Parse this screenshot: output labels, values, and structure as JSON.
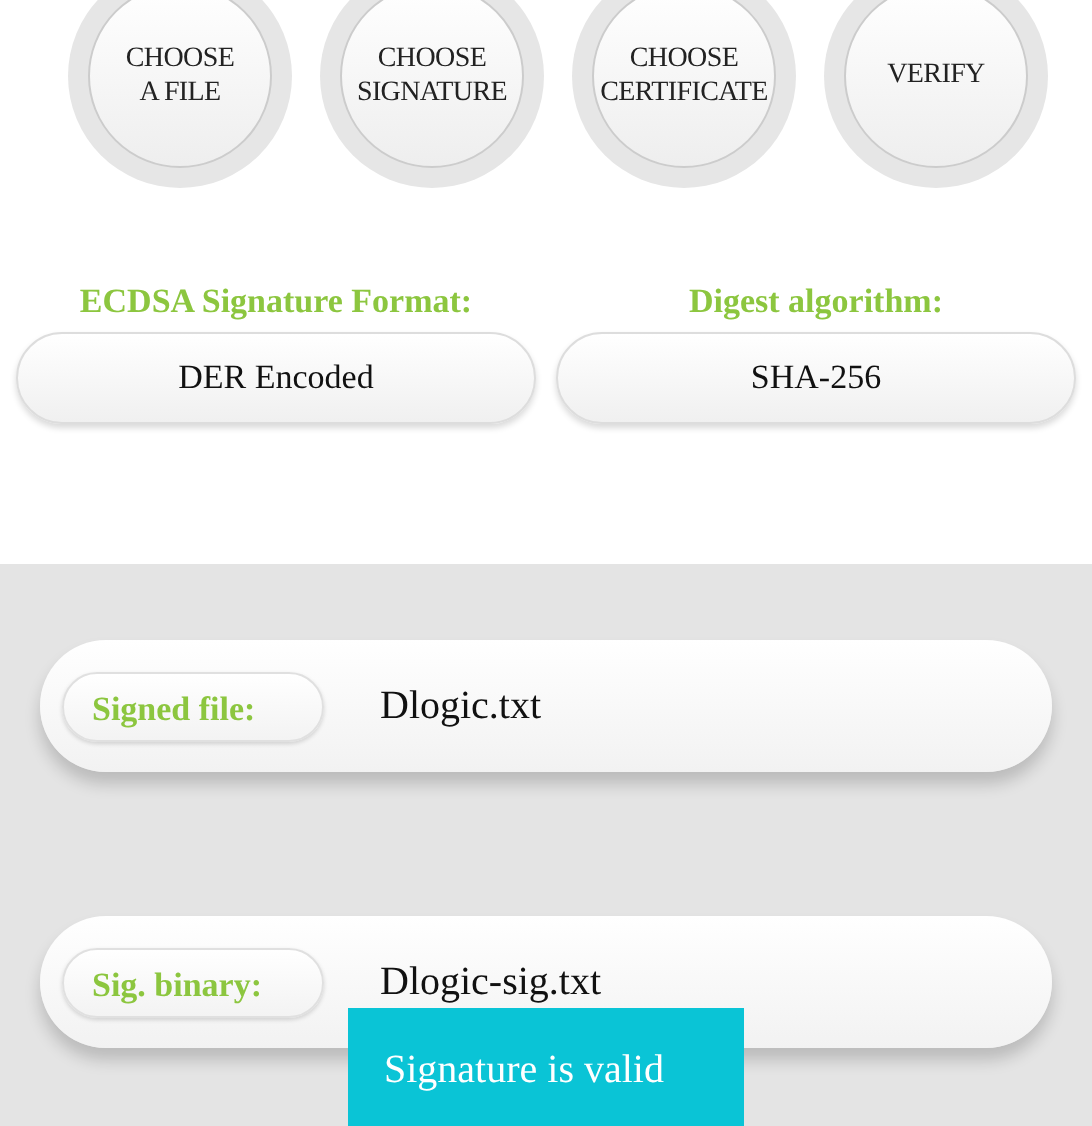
{
  "actions": [
    {
      "lines": [
        "CHOOSE",
        "A FILE"
      ]
    },
    {
      "lines": [
        "CHOOSE",
        "SIGNATURE"
      ]
    },
    {
      "lines": [
        "CHOOSE",
        "CERTIFICATE"
      ]
    },
    {
      "lines": [
        "VERIFY"
      ]
    }
  ],
  "options": [
    {
      "label": "ECDSA Signature Format:",
      "value": "DER Encoded"
    },
    {
      "label": "Digest algorithm:",
      "value": "SHA-256"
    }
  ],
  "files": [
    {
      "label": "Signed file:",
      "value": "Dlogic.txt"
    },
    {
      "label": "Sig. binary:",
      "value": "Dlogic-sig.txt"
    }
  ],
  "toast": "Signature is valid"
}
